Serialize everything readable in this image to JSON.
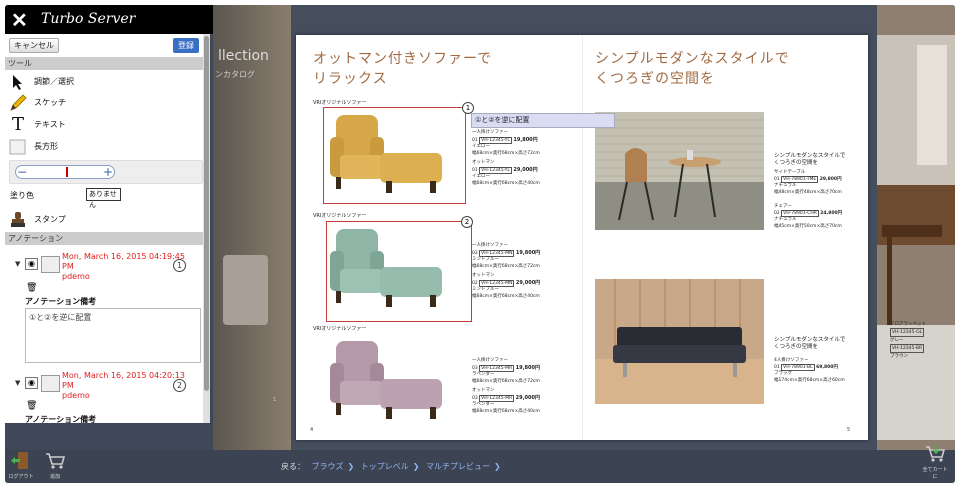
{
  "app": {
    "name": "Turbo Server"
  },
  "panel": {
    "cancel_label": "キャンセル",
    "save_label": "登録",
    "tools_header": "ツール",
    "tools": [
      {
        "label": "調節／選択",
        "icon": "arrow-cursor-icon"
      },
      {
        "label": "スケッチ",
        "icon": "pencil-icon"
      },
      {
        "label": "テキスト",
        "icon": "text-t-icon"
      },
      {
        "label": "長方形",
        "icon": "rectangle-icon"
      }
    ],
    "fill_label": "塗り色",
    "fill_value": "ありません",
    "stamp_label": "スタンプ",
    "annotation_header": "アノテーション",
    "annotations": [
      {
        "date": "Mon, March 16, 2015 04:19:45",
        "ampm": "PM",
        "user": "pdemo",
        "num": "1",
        "note_label": "アノテーション備考",
        "note": "①と②を逆に配置"
      },
      {
        "date": "Mon, March 16, 2015 04:20:13",
        "ampm": "PM",
        "user": "pdemo",
        "num": "2",
        "note_label": "アノテーション備考"
      }
    ]
  },
  "left_page": {
    "line1": "llection",
    "line2": "ンカタログ",
    "pnum": "1"
  },
  "book": {
    "left_title": [
      "オットマン付きソファーで",
      "リラックス"
    ],
    "right_title": [
      "シンプルモダンなスタイルで",
      "くつろぎの空間を"
    ],
    "products": [
      {
        "label": "VRIオリジナルソファー",
        "num": "1",
        "sofa": "一人掛けソファー",
        "sofa_code": "VH-12345-YL",
        "sofa_price": "19,800円",
        "sofa_color": "イエロー",
        "sofa_size": "幅68cm×奥行68cm×高さ72cm",
        "ott": "オットマン",
        "ott_code": "VH-12345-YL",
        "ott_price": "29,000円",
        "ott_color": "イエロー",
        "ott_size": "幅68cm×奥行68cm×高さ40cm",
        "color": "#d6a84a"
      },
      {
        "label": "VRIオリジナルソファー",
        "num": "2",
        "sofa": "一人掛けソファー",
        "sofa_code": "VH-12345-MN",
        "sofa_price": "19,800円",
        "sofa_color": "ミントブルー",
        "sofa_size": "幅68cm×奥行68cm×高さ72cm",
        "ott": "オットマン",
        "ott_code": "VH-12345-MN",
        "ott_price": "29,000円",
        "ott_color": "ミントブルー",
        "ott_size": "幅68cm×奥行68cm×高さ40cm",
        "color": "#8fb5a6"
      },
      {
        "label": "VRIオリジナルソファー",
        "sofa": "一人掛けソファー",
        "sofa_code": "VH-12345-MR",
        "sofa_price": "19,800円",
        "sofa_color": "ラベンダー",
        "sofa_size": "幅68cm×奥行68cm×高さ72cm",
        "ott": "オットマン",
        "ott_code": "VH-12345-MR",
        "ott_price": "29,000円",
        "ott_color": "ラベンダー",
        "ott_size": "幅68cm×奥行68cm×高さ40cm",
        "color": "#b49aa8"
      }
    ],
    "tooltip": "①と②を逆に配置",
    "right_items": [
      {
        "head": "シンプルモダンなスタイルで",
        "head2": "くつろぎの空間を",
        "l1": "サイドテーブル",
        "code1": "VH-78901-TME",
        "price1": "29,800円",
        "c1": "ナチュラル",
        "s1": "幅48cm×奥行48cm×高さ70cm",
        "l2": "チェアー",
        "code2": "VH-78901-CHR",
        "price2": "24,800円",
        "c2": "ナチュラル",
        "s2": "幅45cm×奥行50cm×高さ70cm"
      },
      {
        "head": "シンプルモダンなスタイルで",
        "head2": "くつろぎの空間を",
        "l1": "4人掛けソファー",
        "code1": "VH-78901-BL",
        "price1": "69,800円",
        "c1": "ブラック",
        "s1": "幅174cm×奥行68cm×高さ60cm"
      }
    ],
    "page_left": "4",
    "page_right": "5"
  },
  "right_peek": {
    "label": "フロアランペット",
    "code1": "VH-12345-GL",
    "c1": "グレー",
    "code2": "VH-12345-BR",
    "c2": "ブラウン"
  },
  "footer": {
    "logout": "ログアウト",
    "add": "追加",
    "back": "戻る：",
    "crumbs": [
      "ブラウズ",
      "トップレベル",
      "マルチプレビュー"
    ],
    "all_cart": "全てカートに"
  },
  "colors": {
    "accent": "#3a6fc6",
    "annotation": "#c83c3c",
    "title": "#a06a42"
  }
}
